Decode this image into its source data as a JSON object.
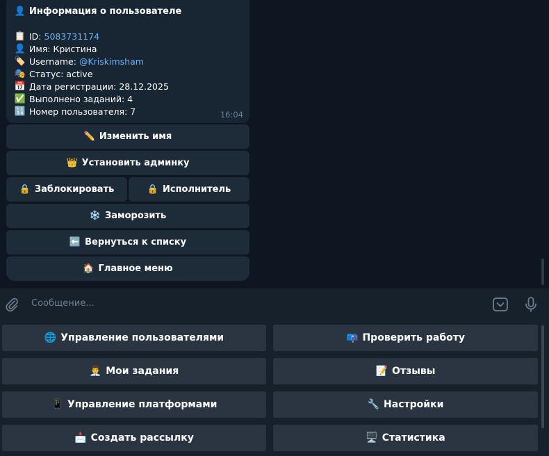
{
  "message": {
    "title_icon": "👤",
    "title": "Информация о пользователе",
    "lines": [
      {
        "icon": "📋",
        "label": "ID: ",
        "value": "5083731174",
        "link": true
      },
      {
        "icon": "👤",
        "label": "Имя: Кристина",
        "value": "",
        "link": false
      },
      {
        "icon": "🏷️",
        "label": "Username: ",
        "value": "@Kriskimsham",
        "link": true
      },
      {
        "icon": "🎭",
        "label": "Статус: active",
        "value": "",
        "link": false
      },
      {
        "icon": "📅",
        "label": "Дата регистрации: 28.12.2025",
        "value": "",
        "link": false
      },
      {
        "icon": "✅",
        "label": "Выполнено заданий: 4",
        "value": "",
        "link": false
      },
      {
        "icon": "🔢",
        "label": "Номер пользователя: 7",
        "value": "",
        "link": false
      }
    ],
    "time": "16:04"
  },
  "inline_buttons": {
    "rename": {
      "icon": "✏️",
      "label": "Изменить имя"
    },
    "set_admin": {
      "icon": "👑",
      "label": "Установить админку"
    },
    "block": {
      "icon": "🔒",
      "label": "Заблокировать"
    },
    "executor": {
      "icon": "🔒",
      "label": "Исполнитель"
    },
    "freeze": {
      "icon": "❄️",
      "label": "Заморозить"
    },
    "back_to_list": {
      "icon": "⬅️",
      "label": "Вернуться к списку"
    },
    "main_menu": {
      "icon": "🏠",
      "label": "Главное меню"
    }
  },
  "composer": {
    "placeholder": "Сообщение..."
  },
  "keyboard": {
    "manage_users": {
      "icon": "🌐",
      "label": "Управление пользователями"
    },
    "check_work": {
      "icon": "📪",
      "label": "Проверить работу"
    },
    "my_tasks": {
      "icon": "👨‍💼",
      "label": "Мои задания"
    },
    "reviews": {
      "icon": "📝",
      "label": "Отзывы"
    },
    "manage_platforms": {
      "icon": "📱",
      "label": "Управление платформами"
    },
    "settings": {
      "icon": "🔧",
      "label": "Настройки"
    },
    "create_mailing": {
      "icon": "📩",
      "label": "Создать рассылку"
    },
    "statistics": {
      "icon": "🖥️",
      "label": "Статистика"
    }
  }
}
